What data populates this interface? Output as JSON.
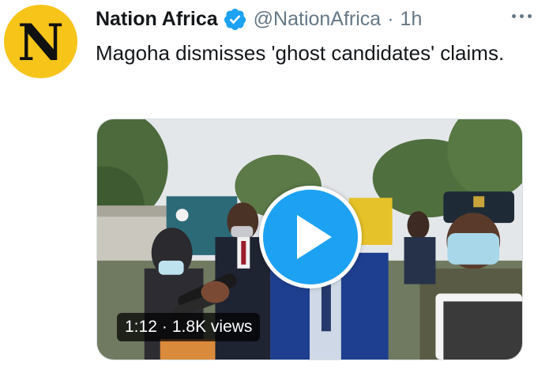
{
  "tweet": {
    "avatar_letter": "N",
    "display_name": "Nation Africa",
    "handle": "@NationAfrica",
    "separator": "·",
    "time": "1h",
    "text": "Magoha dismisses 'ghost candidates' claims."
  },
  "video": {
    "duration": "1:12",
    "separator": "·",
    "views": "1.8K views"
  },
  "icons": {
    "verified": "verified-badge-icon",
    "play": "play-icon",
    "more": "more-horizontal-icon"
  },
  "colors": {
    "accent": "#1da1f2",
    "avatar_bg": "#f7c41a",
    "secondary_text": "#657786"
  }
}
